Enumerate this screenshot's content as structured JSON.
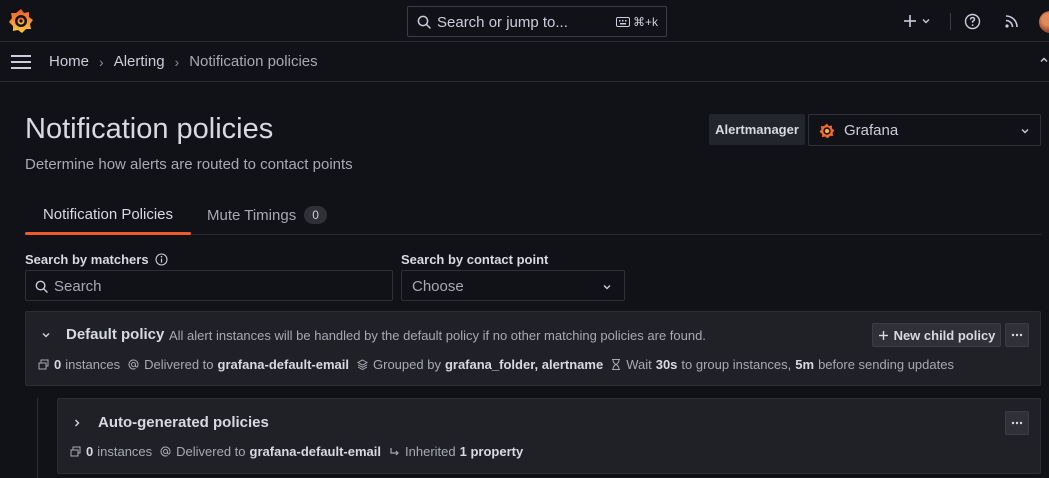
{
  "topbar": {
    "search_placeholder": "Search or jump to...",
    "search_shortcut": "⌘+k",
    "icons": [
      "grafana-logo-icon",
      "search-icon",
      "keyboard-icon",
      "plus-icon",
      "chevron-down-icon",
      "help-icon",
      "rss-icon",
      "avatar"
    ]
  },
  "breadcrumb": [
    "Home",
    "Alerting",
    "Notification policies"
  ],
  "page": {
    "title": "Notification policies",
    "subtitle": "Determine how alerts are routed to contact points"
  },
  "alertmanager": {
    "label": "Alertmanager",
    "value": "Grafana"
  },
  "tabs": [
    {
      "label": "Notification Policies",
      "active": true
    },
    {
      "label": "Mute Timings",
      "count": "0",
      "active": false
    }
  ],
  "filters": {
    "matchers_label": "Search by matchers",
    "matchers_placeholder": "Search",
    "contact_label": "Search by contact point",
    "contact_placeholder": "Choose"
  },
  "default_policy": {
    "title": "Default policy",
    "description": "All alert instances will be handled by the default policy if no other matching policies are found.",
    "new_child_label": "New child policy",
    "instances_count": "0",
    "instances_word": "instances",
    "delivered_prefix": "Delivered to",
    "contact_point": "grafana-default-email",
    "grouped_prefix": "Grouped by",
    "grouped_by": "grafana_folder, alertname",
    "wait_prefix": "Wait",
    "wait_value": "30s",
    "wait_mid": "to group instances,",
    "repeat_value": "5m",
    "wait_suffix": "before sending updates"
  },
  "child_policy": {
    "title": "Auto-generated policies",
    "instances_count": "0",
    "instances_word": "instances",
    "delivered_prefix": "Delivered to",
    "contact_point": "grafana-default-email",
    "inherited_prefix": "Inherited",
    "inherited_value": "1 property"
  },
  "colors": {
    "accent": "#f05a28",
    "background": "#111217",
    "panel": "#1f2127"
  }
}
